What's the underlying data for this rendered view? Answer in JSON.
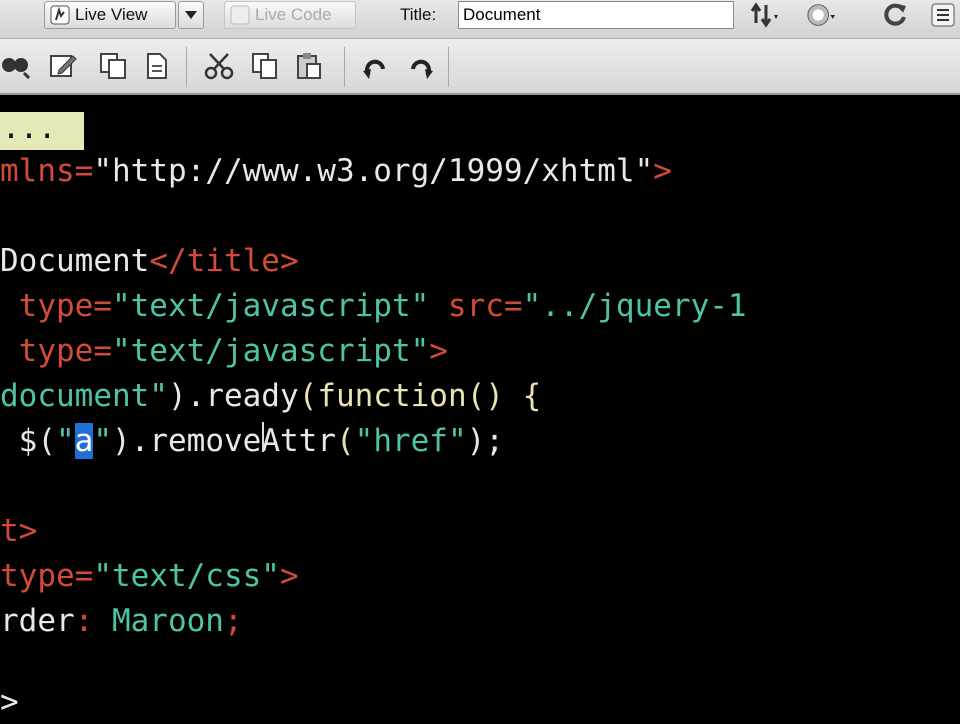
{
  "toolbar": {
    "live_view_label": "Live View",
    "live_code_label": "Live Code",
    "title_label": "Title:",
    "title_value": "Document"
  },
  "editor": {
    "collapsed_marker": "...",
    "lines": [
      {
        "parts": [
          {
            "t": "mlns=",
            "c": "attr"
          },
          {
            "t": "\"http://www.w3.org/1999/xhtml\"",
            "c": "str-white"
          },
          {
            "t": ">",
            "c": "tag"
          }
        ]
      },
      {
        "parts": [
          {
            "t": "Document",
            "c": "plain"
          },
          {
            "t": "</title>",
            "c": "tag"
          }
        ]
      },
      {
        "parts": [
          {
            "t": " type=",
            "c": "attr"
          },
          {
            "t": "\"text/javascript\"",
            "c": "str"
          },
          {
            "t": " src=",
            "c": "attr"
          },
          {
            "t": "\"../jquery-1",
            "c": "str"
          }
        ]
      },
      {
        "parts": [
          {
            "t": " type=",
            "c": "attr"
          },
          {
            "t": "\"text/javascript\"",
            "c": "str"
          },
          {
            "t": ">",
            "c": "tag"
          }
        ]
      },
      {
        "parts": [
          {
            "t": "document\"",
            "c": "str"
          },
          {
            "t": ").",
            "c": "plain"
          },
          {
            "t": "ready",
            "c": "plain"
          },
          {
            "t": "(",
            "c": "punct"
          },
          {
            "t": "function",
            "c": "fn"
          },
          {
            "t": "() {",
            "c": "punct"
          }
        ]
      },
      {
        "parts": [
          {
            "t": " $(",
            "c": "plain"
          },
          {
            "t": "\"",
            "c": "str"
          },
          {
            "t": "a",
            "c": "sel"
          },
          {
            "t": "\"",
            "c": "str"
          },
          {
            "t": ").",
            "c": "plain"
          },
          {
            "t": "removeAttr",
            "c": "plain"
          },
          {
            "t": "(",
            "c": "punct"
          },
          {
            "t": "\"href\"",
            "c": "str"
          },
          {
            "t": ");",
            "c": "plain"
          }
        ]
      },
      {
        "parts": [
          {
            "t": "t>",
            "c": "tag"
          }
        ]
      },
      {
        "parts": [
          {
            "t": "type=",
            "c": "attr"
          },
          {
            "t": "\"text/css\"",
            "c": "str"
          },
          {
            "t": ">",
            "c": "tag"
          }
        ]
      },
      {
        "parts": [
          {
            "t": "rder",
            "c": "plain"
          },
          {
            "t": ": ",
            "c": "attr"
          },
          {
            "t": "Maroon",
            "c": "str"
          },
          {
            "t": ";",
            "c": "tag"
          }
        ]
      },
      {
        "parts": [
          {
            "t": ">",
            "c": "plain"
          }
        ]
      }
    ]
  },
  "colors": {
    "background": "#000000",
    "tag": "#d24a3a",
    "string": "#4fc3a6",
    "selection": "#1f6fd6"
  }
}
